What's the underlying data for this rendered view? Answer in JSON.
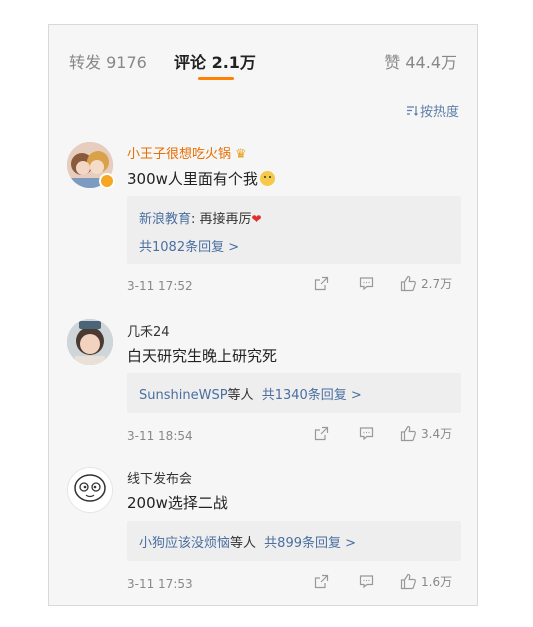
{
  "tabs": {
    "repost": "转发 9176",
    "comments": "评论 2.1万",
    "likes": "赞 44.4万"
  },
  "sort": {
    "icon": "sort-lines-icon",
    "label": "按热度"
  },
  "comments": [
    {
      "author": "小王子很想吃火锅",
      "author_badge": "crown-icon",
      "content": "300w人里面有个我",
      "content_emoji": "smiley-emoji",
      "reply_preview": {
        "name": "新浪教育",
        "text": ": 再接再厉",
        "emoji": "heart"
      },
      "reply_link": "共1082条回复 >",
      "time": "3-11 17:52",
      "likes": "2.7万"
    },
    {
      "author": "几禾24",
      "content": "白天研究生晚上研究死",
      "reply_names": "SunshineWSP",
      "reply_suffix": "等人",
      "reply_link": "共1340条回复 >",
      "time": "3-11 18:54",
      "likes": "3.4万"
    },
    {
      "author": "线下发布会",
      "content": "200w选择二战",
      "reply_names": "小狗应该没烦恼",
      "reply_suffix": "等人",
      "reply_link": "共899条回复 >",
      "time": "3-11 17:53",
      "likes": "1.6万"
    }
  ],
  "colors": {
    "accent": "#ff8200",
    "link": "#4a6fa0",
    "vip_name": "#e86e00"
  }
}
